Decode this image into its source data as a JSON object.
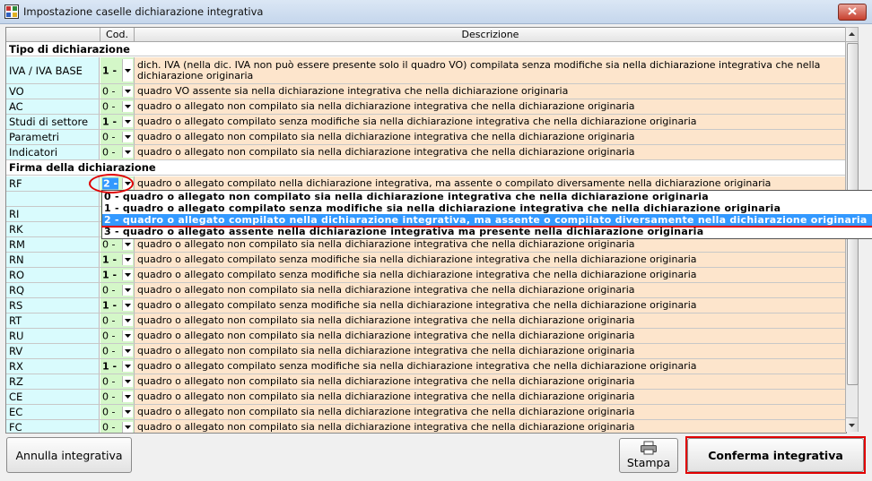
{
  "window": {
    "title": "Impostazione caselle dichiarazione integrativa"
  },
  "columns": {
    "code": "Cod.",
    "description": "Descrizione"
  },
  "rows": [
    {
      "kind": "section",
      "label": "Tipo di dichiarazione"
    },
    {
      "kind": "item",
      "name": "IVA / IVA BASE",
      "code": "1 -",
      "desc": "dich. IVA (nella dic. IVA non può essere presente solo il quadro VO) compilata senza modifiche sia nella dichiarazione integrativa che nella dichiarazione originaria"
    },
    {
      "kind": "item",
      "name": "VO",
      "code": "0 -",
      "desc": "quadro VO assente sia nella dichiarazione integrativa che nella dichiarazione originaria"
    },
    {
      "kind": "item",
      "name": "AC",
      "code": "0 -",
      "desc": "quadro o allegato non compilato sia nella dichiarazione integrativa che nella dichiarazione originaria"
    },
    {
      "kind": "item",
      "name": "Studi di settore",
      "code": "1 -",
      "desc": "quadro o allegato compilato senza modifiche sia nella dichiarazione integrativa che nella dichiarazione originaria"
    },
    {
      "kind": "item",
      "name": "Parametri",
      "code": "0 -",
      "desc": "quadro o allegato non compilato sia nella dichiarazione integrativa che nella dichiarazione originaria"
    },
    {
      "kind": "item",
      "name": "Indicatori",
      "code": "0 -",
      "desc": "quadro o allegato non compilato sia nella dichiarazione integrativa che nella dichiarazione originaria"
    },
    {
      "kind": "section",
      "label": "Firma della dichiarazione"
    },
    {
      "kind": "item",
      "name": "RF",
      "code": "2 -",
      "desc": "quadro o allegato compilato nella dichiarazione integrativa, ma assente o compilato diversamente nella dichiarazione originaria",
      "selected": true
    },
    {
      "kind": "item",
      "name": "",
      "code": "",
      "desc": ""
    },
    {
      "kind": "item",
      "name": "RI",
      "code": "",
      "desc": ""
    },
    {
      "kind": "item",
      "name": "RK",
      "code": "",
      "desc": ""
    },
    {
      "kind": "item",
      "name": "RM",
      "code": "0 -",
      "desc": "quadro o allegato non compilato sia nella dichiarazione integrativa che nella dichiarazione originaria"
    },
    {
      "kind": "item",
      "name": "RN",
      "code": "1 -",
      "desc": "quadro o allegato compilato senza modifiche sia nella dichiarazione integrativa che nella dichiarazione originaria"
    },
    {
      "kind": "item",
      "name": "RO",
      "code": "1 -",
      "desc": "quadro o allegato compilato senza modifiche sia nella dichiarazione integrativa che nella dichiarazione originaria"
    },
    {
      "kind": "item",
      "name": "RQ",
      "code": "0 -",
      "desc": "quadro o allegato non compilato sia nella dichiarazione integrativa che nella dichiarazione originaria"
    },
    {
      "kind": "item",
      "name": "RS",
      "code": "1 -",
      "desc": "quadro o allegato compilato senza modifiche sia nella dichiarazione integrativa che nella dichiarazione originaria"
    },
    {
      "kind": "item",
      "name": "RT",
      "code": "0 -",
      "desc": "quadro o allegato non compilato sia nella dichiarazione integrativa che nella dichiarazione originaria"
    },
    {
      "kind": "item",
      "name": "RU",
      "code": "0 -",
      "desc": "quadro o allegato non compilato sia nella dichiarazione integrativa che nella dichiarazione originaria"
    },
    {
      "kind": "item",
      "name": "RV",
      "code": "0 -",
      "desc": "quadro o allegato non compilato sia nella dichiarazione integrativa che nella dichiarazione originaria"
    },
    {
      "kind": "item",
      "name": "RX",
      "code": "1 -",
      "desc": "quadro o allegato compilato senza modifiche sia nella dichiarazione integrativa che nella dichiarazione originaria"
    },
    {
      "kind": "item",
      "name": "RZ",
      "code": "0 -",
      "desc": "quadro o allegato non compilato sia nella dichiarazione integrativa che nella dichiarazione originaria"
    },
    {
      "kind": "item",
      "name": "CE",
      "code": "0 -",
      "desc": "quadro o allegato non compilato sia nella dichiarazione integrativa che nella dichiarazione originaria"
    },
    {
      "kind": "item",
      "name": "EC",
      "code": "0 -",
      "desc": "quadro o allegato non compilato sia nella dichiarazione integrativa che nella dichiarazione originaria"
    },
    {
      "kind": "item",
      "name": "FC",
      "code": "0 -",
      "desc": "quadro o allegato non compilato sia nella dichiarazione integrativa che nella dichiarazione originaria"
    }
  ],
  "dropdown": {
    "options": [
      "0 - quadro o allegato non compilato sia nella dichiarazione integrativa che nella dichiarazione originaria",
      "1 - quadro o allegato compilato senza modifiche sia nella dichiarazione integrativa che nella dichiarazione originaria",
      "2 - quadro o allegato compilato nella dichiarazione integrativa, ma assente o compilato diversamente nella dichiarazione originaria",
      "3 - quadro o allegato assente nella dichiarazione integrativa ma presente nella dichiarazione originaria"
    ],
    "selected_index": 2
  },
  "buttons": {
    "cancel": "Annulla integrativa",
    "print": "Stampa",
    "confirm": "Conferma integrativa"
  },
  "icons": {
    "app": "app-icon",
    "close": "close-icon",
    "printer": "printer-icon",
    "dropdown": "chevron-down-icon"
  }
}
